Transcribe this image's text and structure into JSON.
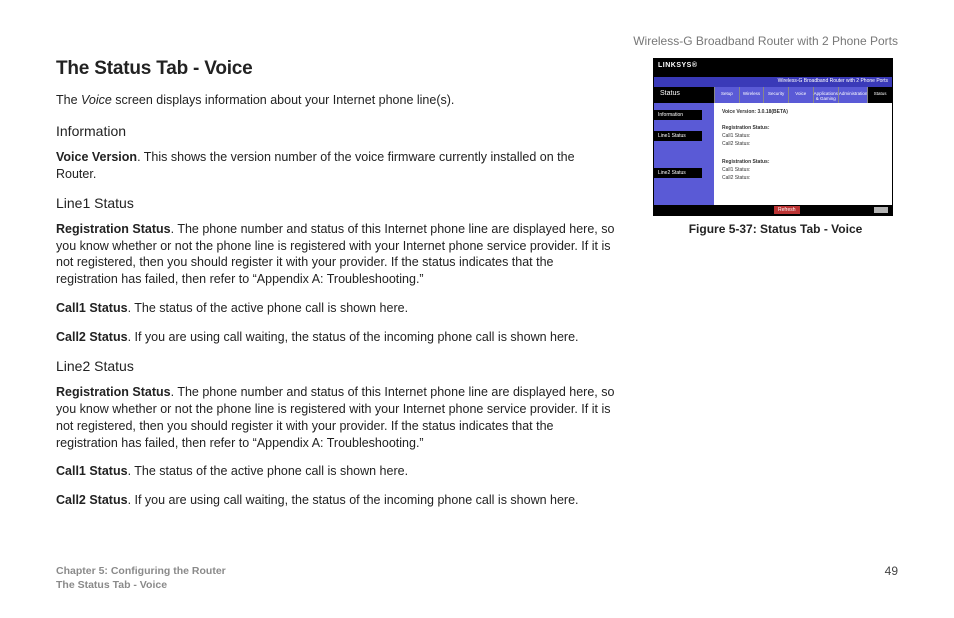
{
  "header_right": "Wireless-G Broadband Router with 2 Phone Ports",
  "title": "The Status Tab - Voice",
  "intro_pre": "The ",
  "intro_ital": "Voice",
  "intro_post": " screen displays information about your Internet phone line(s).",
  "sec_info": "Information",
  "voice_version_b": "Voice Version",
  "voice_version_t": ". This shows the version number of the voice firmware currently installed on the Router.",
  "sec_line1": "Line1 Status",
  "reg_b": "Registration Status",
  "reg_t": ". The phone number and status of this Internet phone line are displayed here, so you know whether or not the phone line is registered with your Internet phone service provider. If it is not registered, then you should register it with your provider. If the status indicates that the registration has failed, then refer to “Appendix A: Troubleshooting.”",
  "call1_b": "Call1 Status",
  "call1_t": ". The status of the active phone call is shown here.",
  "call2_b": "Call2 Status",
  "call2_t": ". If you are using call waiting, the status of the incoming phone call is shown here.",
  "sec_line2": "Line2 Status",
  "fig_caption": "Figure 5-37: Status Tab - Voice",
  "foot_chapter": "Chapter 5: Configuring the Router",
  "foot_section": "The Status Tab - Voice",
  "page_num": "49",
  "ss": {
    "brand": "LINKSYS®",
    "titlebar": "Wireless-G Broadband Router with 2 Phone Ports",
    "status": "Status",
    "tabs": [
      "Setup",
      "Wireless",
      "Security",
      "Voice",
      "Applications & Gaming",
      "Administration",
      "Status"
    ],
    "left_labels": [
      "Information",
      "Line1 Status",
      "Line2 Status"
    ],
    "vv": "Voice Version: 3.0.18(BETA)",
    "rs": "Registration Status:",
    "c1": "Call1 Status:",
    "c2": "Call2 Status:",
    "btn": "Refresh"
  }
}
